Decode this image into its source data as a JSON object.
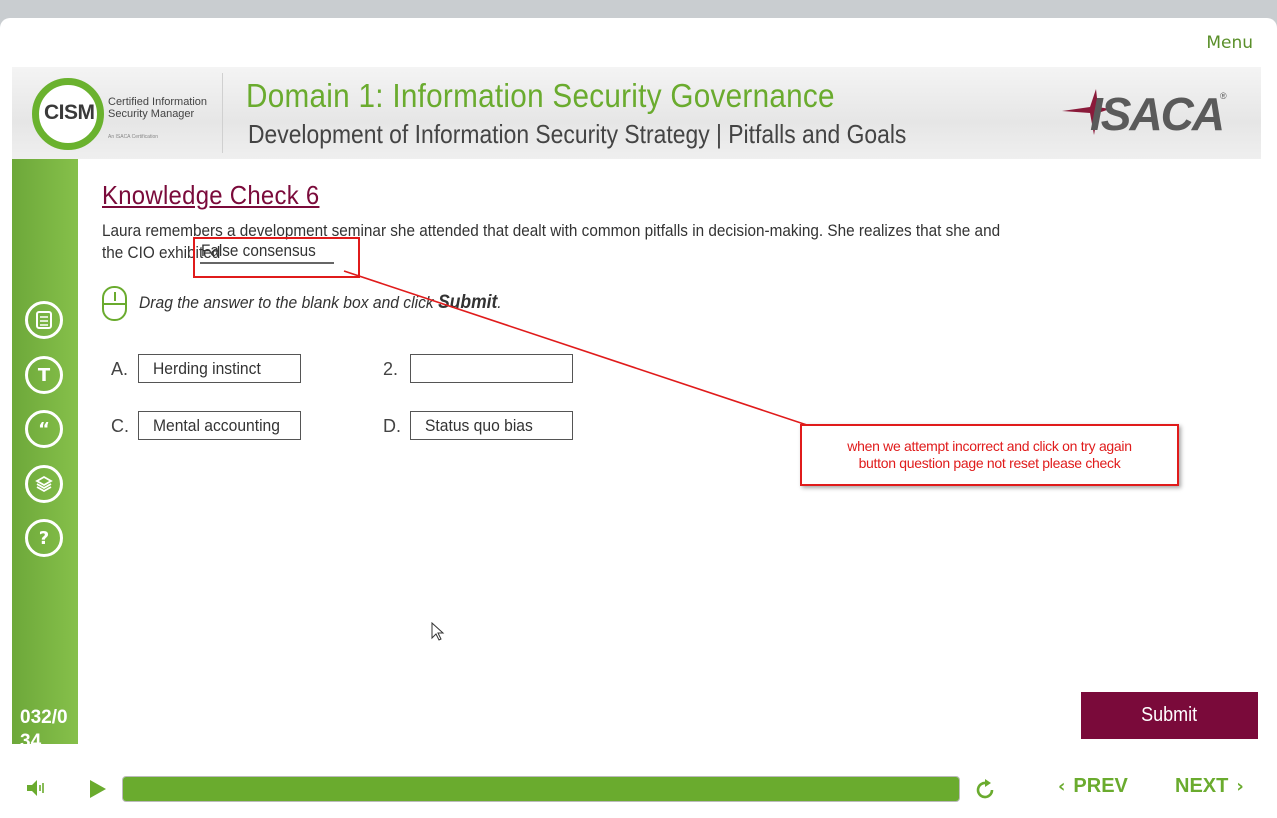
{
  "header": {
    "menu_label": "Menu"
  },
  "banner": {
    "cism_word": "CISM",
    "cism_line1": "Certified Information",
    "cism_line2": "Security Manager",
    "cism_small": "An ISACA Certification",
    "title": "Domain 1: Information Security Governance",
    "subtitle": "Development of Information Security Strategy | Pitfalls and Goals",
    "isaca_word": "ISACA"
  },
  "sidebar": {
    "icons": [
      "notes-icon",
      "transcript-icon",
      "quote-icon",
      "resources-icon",
      "help-icon"
    ],
    "page_counter": "032/034"
  },
  "question": {
    "title": "Knowledge Check 6",
    "text": "Laura remembers a development seminar she attended that dealt with common pitfalls in decision-making. She realizes that she and the CIO exhibited",
    "filled_answer": "False consensus",
    "instruction": "Drag the answer to the blank box and click",
    "instruction_bold": "Submit",
    "instruction_end": "."
  },
  "options": [
    {
      "letter": "A.",
      "label": "Herding instinct"
    },
    {
      "letter": "2.",
      "label": ""
    },
    {
      "letter": "C.",
      "label": "Mental accounting"
    },
    {
      "letter": "D.",
      "label": "Status quo bias"
    }
  ],
  "annotation": {
    "line1": "when we attempt incorrect and click on try again",
    "line2": "button question page not reset please check",
    "color": "#e01b1b"
  },
  "submit_label": "Submit",
  "controls": {
    "progress": 1.0,
    "prev_label": "PREV",
    "next_label": "NEXT"
  },
  "colors": {
    "brand_green": "#6aab2e",
    "brand_maroon": "#7a0a3a"
  }
}
